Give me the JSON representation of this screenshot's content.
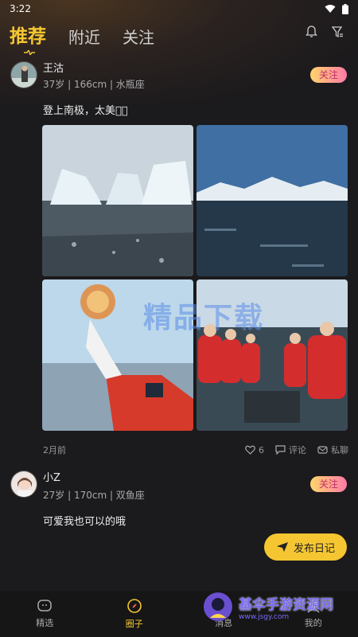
{
  "status_bar": {
    "time": "3:22"
  },
  "header": {
    "tabs": [
      {
        "label": "推荐",
        "active": true
      },
      {
        "label": "附近",
        "active": false
      },
      {
        "label": "关注",
        "active": false
      }
    ]
  },
  "posts": [
    {
      "name": "王沽",
      "meta": "37岁 | 166cm | 水瓶座",
      "follow_label": "关注",
      "caption": "登上南极，太美了🏻",
      "time": "2月前",
      "likes": "6",
      "comment_label": "评论",
      "message_label": "私聊"
    },
    {
      "name": "小Z",
      "meta": "27岁 | 170cm | 双鱼座",
      "follow_label": "关注",
      "caption": "可爱我也可以的哦"
    }
  ],
  "publish_button": {
    "label": "发布日记"
  },
  "bottom_nav": [
    {
      "label": "精选",
      "icon": "chat-bubble-icon",
      "active": false
    },
    {
      "label": "圈子",
      "icon": "circle-compass-icon",
      "active": true
    },
    {
      "label": "消息",
      "icon": "message-icon",
      "active": false
    },
    {
      "label": "我的",
      "icon": "profile-icon",
      "active": false
    }
  ],
  "watermarks": {
    "center": "精品下载",
    "corner": "基伞手游资源网",
    "corner_url": "www.jsgy.com"
  },
  "colors": {
    "accent": "#f5c631",
    "background": "#1b1a1c",
    "follow_gradient_start": "#ffd66b",
    "follow_gradient_end": "#ff7aa8"
  }
}
